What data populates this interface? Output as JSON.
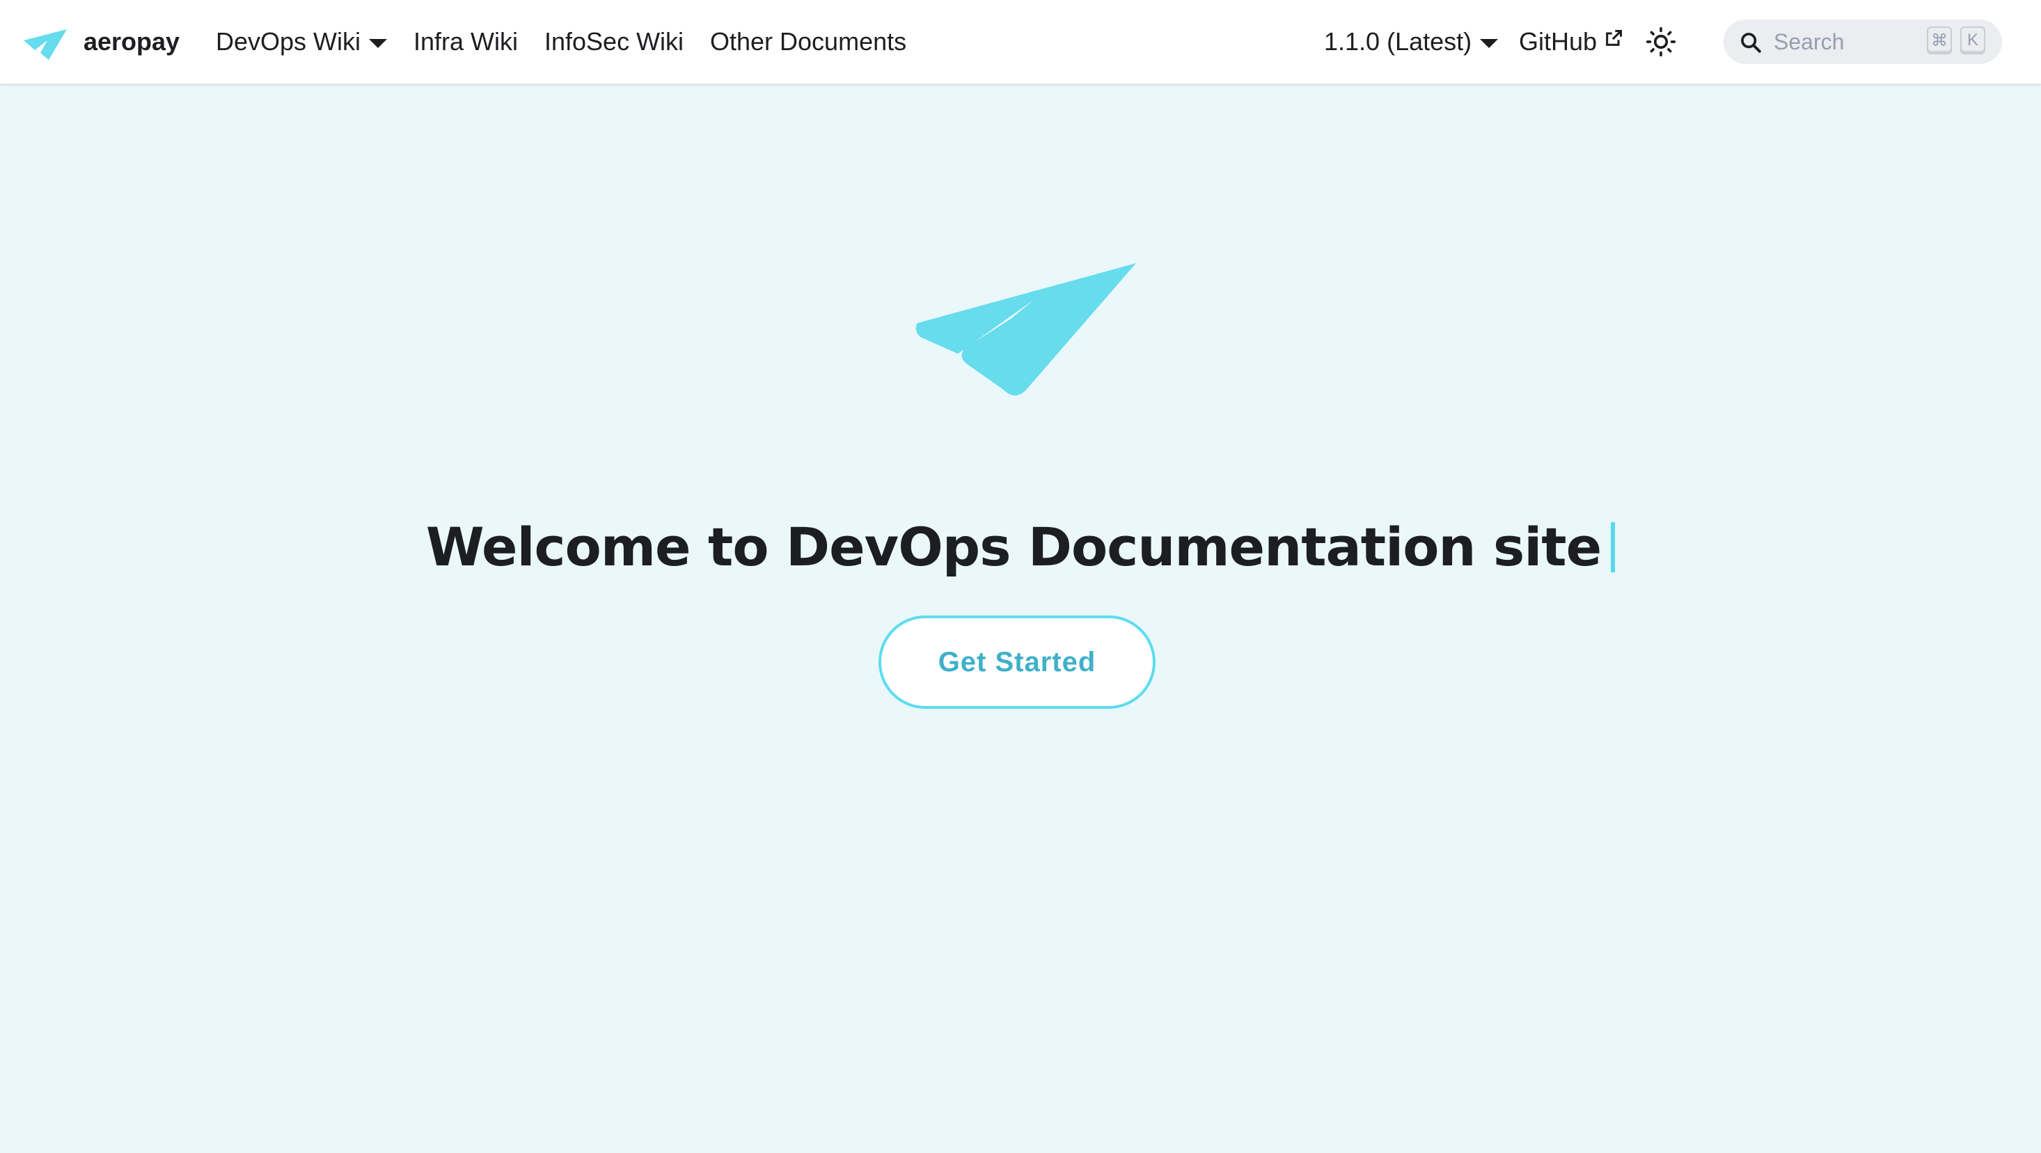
{
  "brand": {
    "name": "aeropay",
    "logo_icon": "paper-plane-icon",
    "accent_color": "#66dcec"
  },
  "navbar": {
    "left_items": [
      {
        "label": "DevOps Wiki",
        "dropdown": true
      },
      {
        "label": "Infra Wiki"
      },
      {
        "label": "InfoSec Wiki"
      },
      {
        "label": "Other Documents"
      }
    ],
    "version": {
      "label": "1.1.0 (Latest)",
      "dropdown": true
    },
    "github": {
      "label": "GitHub",
      "icon": "external-link-icon"
    },
    "theme_toggle_icon": "sun-icon",
    "search": {
      "placeholder": "Search",
      "shortcut_keys": [
        "⌘",
        "K"
      ]
    }
  },
  "hero": {
    "logo_icon": "paper-plane-icon",
    "title": "Welcome to DevOps Documentation site",
    "cta_label": "Get Started",
    "cta_color": "#3fb0c9",
    "background_color": "#eaf8fc"
  }
}
